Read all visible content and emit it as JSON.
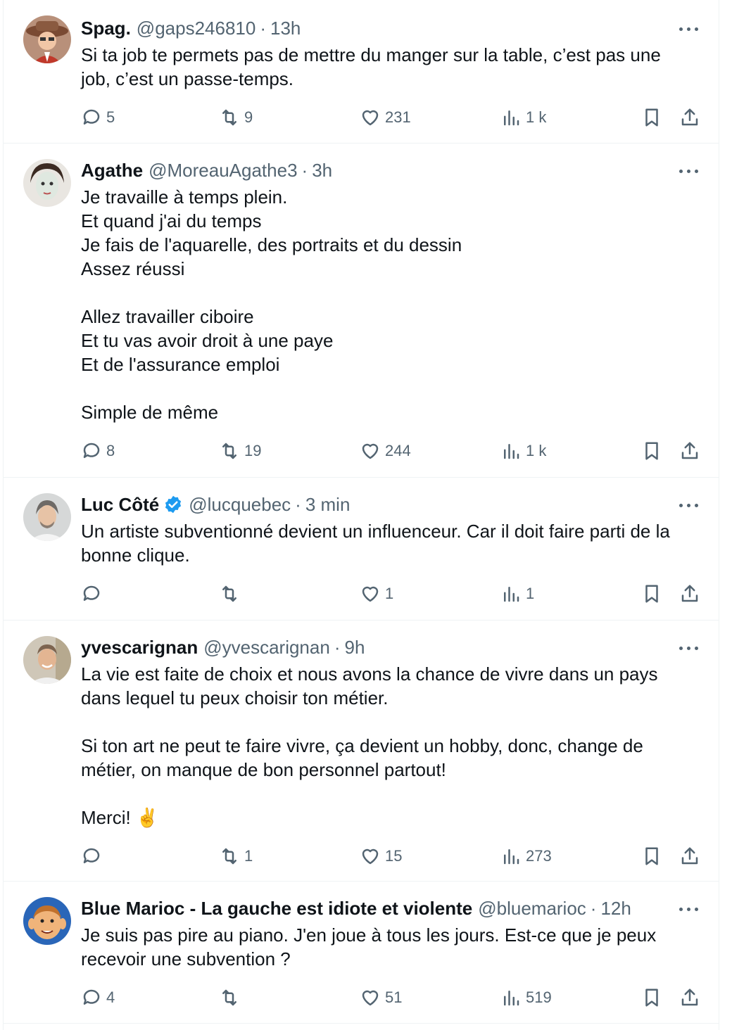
{
  "tweets": [
    {
      "name": "Spag.",
      "handle": "@gaps246810",
      "sep": "·",
      "time": "13h",
      "lines": [
        "Si ta job te permets pas de mettre du manger sur la table, c’est pas une",
        "job, c’est un passe-temps."
      ],
      "replies": "5",
      "retweets": "9",
      "likes": "231",
      "views": "1 k"
    },
    {
      "name": "Agathe",
      "handle": "@MoreauAgathe3",
      "sep": "·",
      "time": "3h",
      "lines": [
        "Je travaille à temps plein.",
        "Et quand j'ai du temps",
        "Je fais de l'aquarelle, des portraits et du dessin",
        "Assez réussi",
        "",
        "Allez travailler ciboire",
        "Et tu vas avoir droit à une paye",
        "Et de l'assurance emploi",
        "",
        "Simple de même"
      ],
      "replies": "8",
      "retweets": "19",
      "likes": "244",
      "views": "1 k"
    },
    {
      "name": "Luc Côté",
      "verified": true,
      "handle": "@lucquebec",
      "sep": "·",
      "time": "3 min",
      "lines": [
        "Un artiste subventionné devient un influenceur. Car il doit faire parti de la",
        "bonne clique."
      ],
      "replies": "",
      "retweets": "",
      "likes": "1",
      "views": "1"
    },
    {
      "name": "yvescarignan",
      "handle": "@yvescarignan",
      "sep": "·",
      "time": "9h",
      "lines": [
        "La vie est faite de choix et nous avons la chance de vivre dans un pays",
        "dans lequel tu peux choisir ton métier.",
        "",
        "Si ton art ne peut te faire vivre, ça devient un hobby, donc, change de",
        "métier, on manque de bon personnel partout!",
        "",
        "Merci! ✌️"
      ],
      "replies": "",
      "retweets": "1",
      "likes": "15",
      "views": "273"
    },
    {
      "name": "Blue Marioc - La gauche est idiote et violente",
      "handle": "@bluemarioc",
      "sep": "·",
      "time": "12h",
      "lines": [
        "Je suis pas pire au piano. J'en joue à tous les jours. Est-ce que je peux",
        "recevoir une subvention ?"
      ],
      "replies": "4",
      "retweets": "",
      "likes": "51",
      "views": "519"
    }
  ],
  "icons": {
    "reply": "reply-icon",
    "retweet": "retweet-icon",
    "like": "heart-icon",
    "views": "views-icon",
    "bookmark": "bookmark-icon",
    "share": "share-icon",
    "more": "more-icon",
    "verified": "verified-badge-icon"
  },
  "colors": {
    "text": "#0f1419",
    "muted": "#536471",
    "verified": "#1d9bf0",
    "divider": "#eff3f4"
  }
}
